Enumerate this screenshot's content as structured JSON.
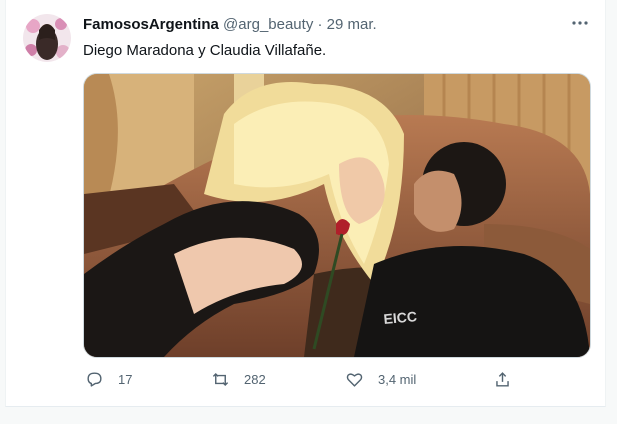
{
  "tweet": {
    "author_name": "FamososArgentina",
    "author_handle": "@arg_beauty",
    "separator": "·",
    "date": "29 mar.",
    "text": "Diego Maradona y Claudia Villafañe."
  },
  "actions": {
    "reply_count": "17",
    "retweet_count": "282",
    "like_count": "3,4 mil"
  },
  "icons": [
    "more-icon",
    "reply-icon",
    "retweet-icon",
    "like-icon",
    "share-icon"
  ],
  "colors": {
    "secondary_text": "#536471",
    "border": "#cfd9de"
  }
}
